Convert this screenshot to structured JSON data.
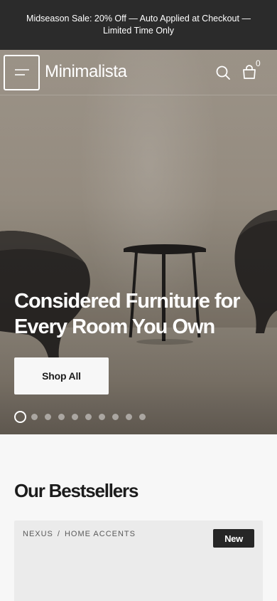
{
  "announcement": {
    "text": "Midseason Sale: 20% Off — Auto Applied at Checkout — Limited Time Only"
  },
  "header": {
    "logo": "Minimalista",
    "cart_count": "0",
    "icons": [
      "menu-icon",
      "search-icon",
      "bag-icon"
    ]
  },
  "hero": {
    "title": "Considered Furniture for Every Room You Own",
    "cta_label": "Shop All",
    "slide_count": 10,
    "active_slide": 1
  },
  "bestsellers": {
    "title": "Our Bestsellers",
    "card": {
      "brand": "NEXUS",
      "separator": "/",
      "category": "HOME ACCENTS",
      "badge": "New"
    }
  },
  "colors": {
    "announcement_bg": "#2b2b2b",
    "page_bg": "#f7f7f7",
    "badge_bg": "#262626",
    "card_bg": "#ebebeb"
  }
}
